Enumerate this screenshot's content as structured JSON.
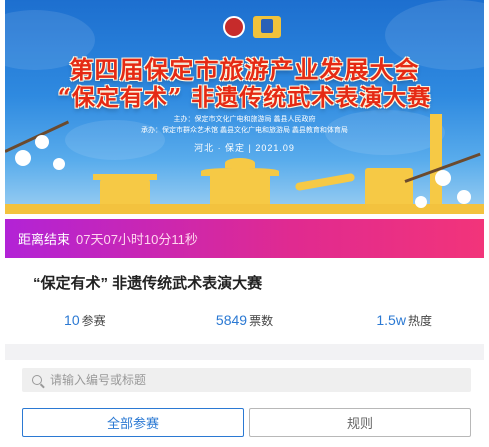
{
  "banner": {
    "title_line1": "第四届保定市旅游产业发展大会",
    "title_line2": "“保定有术” 非遗传统武术表演大赛",
    "host_line1": "主办：保定市文化广电和旅游局    蠡县人民政府",
    "host_line2": "承办：保定市群众艺术馆  蠡县文化广电和旅游局  蠡县教育和体育局",
    "date_line": "河北 · 保定  |  2021.09"
  },
  "countdown": {
    "label": "距离结束",
    "value": "07天07小时10分11秒"
  },
  "contest_title": "“保定有术” 非遗传统武术表演大赛",
  "stats": [
    {
      "value": "10",
      "unit": "参赛"
    },
    {
      "value": "5849",
      "unit": "票数"
    },
    {
      "value": "1.5w",
      "unit": "热度"
    }
  ],
  "search": {
    "placeholder": "请输入编号或标题",
    "value": ""
  },
  "tabs": {
    "all_label": "全部参赛",
    "rules_label": "规则"
  },
  "colors": {
    "accent": "#2b79d3",
    "countdown_start": "#b223d6",
    "countdown_end": "#f2347a",
    "title_red": "#e52a14"
  }
}
